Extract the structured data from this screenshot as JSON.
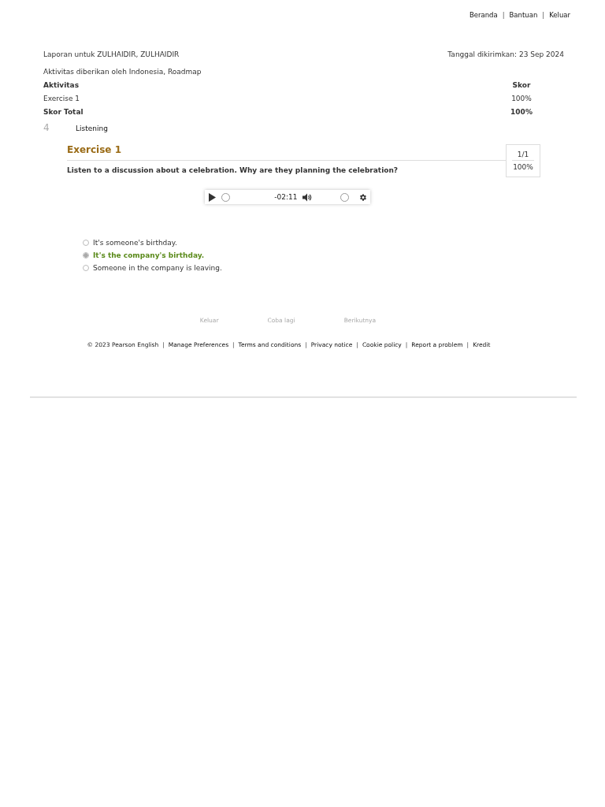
{
  "top_nav": [
    {
      "kind": "link",
      "text": "Beranda"
    },
    {
      "kind": "sep",
      "text": "|"
    },
    {
      "kind": "link",
      "text": "Bantuan"
    },
    {
      "kind": "sep",
      "text": "|"
    },
    {
      "kind": "link",
      "text": "Keluar"
    }
  ],
  "report": {
    "for": "Laporan untuk ZULHAIDIR, ZULHAIDIR",
    "date": "Tanggal dikirimkan: 23 Sep 2024",
    "given_by": "Aktivitas diberikan oleh Indonesia, Roadmap",
    "table": {
      "columns": [
        "Aktivitas",
        "Skor"
      ],
      "rows": [
        {
          "kind": "row",
          "cells": [
            "Exercise 1",
            "100%"
          ]
        },
        {
          "kind": "total",
          "cells": [
            "Skor Total",
            "100%"
          ]
        }
      ]
    }
  },
  "section": {
    "number": "4",
    "title": "Listening"
  },
  "exercise": {
    "title": "Exercise 1",
    "score": {
      "count": "1/1",
      "percent": "100%"
    },
    "question": "Listen to a discussion about a celebration. Why are they planning the celebration?",
    "player": {
      "time": "-02:11"
    },
    "options": [
      {
        "text": "It's someone's birthday.",
        "selected": false,
        "correct": false
      },
      {
        "text": "It's the company's birthday.",
        "selected": true,
        "correct": true
      },
      {
        "text": "Someone in the company is leaving.",
        "selected": false,
        "correct": false
      }
    ]
  },
  "actions": [
    "Keluar",
    "Coba lagi",
    "Berikutnya"
  ],
  "footer": [
    {
      "kind": "text",
      "text": "© 2023 Pearson English"
    },
    {
      "kind": "sep",
      "text": "|"
    },
    {
      "kind": "link",
      "text": "Manage Preferences"
    },
    {
      "kind": "sep",
      "text": "|"
    },
    {
      "kind": "link",
      "text": "Terms and conditions"
    },
    {
      "kind": "sep",
      "text": "|"
    },
    {
      "kind": "link",
      "text": "Privacy notice"
    },
    {
      "kind": "sep",
      "text": "|"
    },
    {
      "kind": "link",
      "text": "Cookie policy"
    },
    {
      "kind": "sep",
      "text": "|"
    },
    {
      "kind": "link",
      "text": "Report a problem"
    },
    {
      "kind": "sep",
      "text": "|"
    },
    {
      "kind": "link",
      "text": "Kredit"
    }
  ]
}
